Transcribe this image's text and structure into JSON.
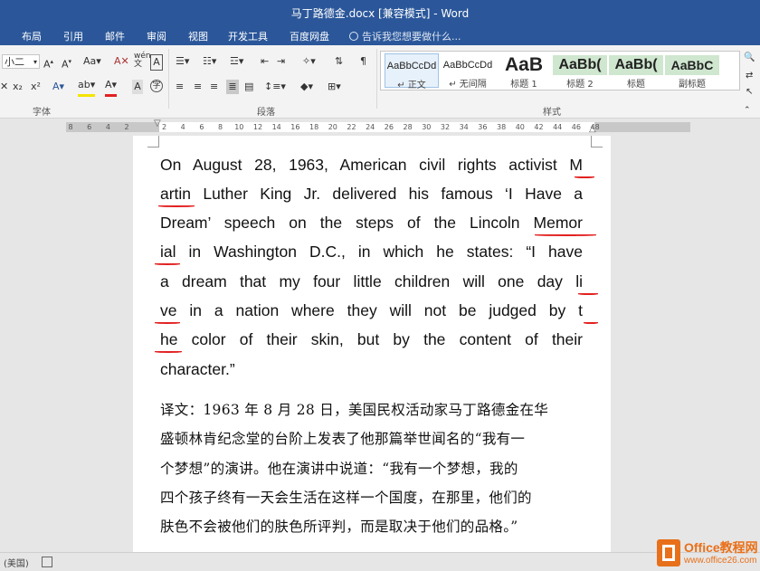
{
  "window": {
    "title": "马丁路德金.docx [兼容模式] - Word"
  },
  "tabs": [
    "布局",
    "引用",
    "邮件",
    "审阅",
    "视图",
    "开发工具",
    "百度网盘"
  ],
  "tell_me": "告诉我您想要做什么...",
  "ribbon": {
    "font_size": "小二",
    "font_group_label": "字体",
    "paragraph_group_label": "段落",
    "styles_group_label": "样式",
    "styles": [
      {
        "preview": "AaBbCcDd",
        "name": "↵ 正文"
      },
      {
        "preview": "AaBbCcDd",
        "name": "↵ 无间隔"
      },
      {
        "preview": "AaB",
        "name": "标题 1"
      },
      {
        "preview": "AaBb(",
        "name": "标题 2"
      },
      {
        "preview": "AaBb(",
        "name": "标题"
      },
      {
        "preview": "AaBbC",
        "name": "副标题"
      }
    ]
  },
  "ruler": {
    "ticks": [
      "8",
      "6",
      "4",
      "2",
      "",
      "2",
      "4",
      "6",
      "8",
      "10",
      "12",
      "14",
      "16",
      "18",
      "20",
      "22",
      "24",
      "26",
      "28",
      "30",
      "32",
      "34",
      "36",
      "38",
      "40",
      "42",
      "44",
      "46",
      "48"
    ]
  },
  "document": {
    "english_lines": [
      "On August 28, 1963, American civil rights activist M",
      "artin Luther King Jr. delivered his famous ‘I Have a",
      " Dream’ speech on the steps of the Lincoln Memor",
      "ial in Washington D.C., in which he states: “I have",
      "a dream that my four little children will one day li",
      "ve in a nation where they will not be judged by t",
      "he color of their skin, but by the content of their",
      "character.”"
    ],
    "chinese_lines": [
      "译文：1963 年 8 月 28 日，美国民权活动家马丁路德金在华",
      "盛顿林肯纪念堂的台阶上发表了他那篇举世闻名的“我有一",
      "个梦想”的演讲。他在演讲中说道：“我有一个梦想，我的",
      "四个孩子终有一天会生活在这样一个国度，在那里，他们的",
      "肤色不会被他们的肤色所评判，而是取决于他们的品格。”"
    ]
  },
  "status": {
    "language": "(美国)"
  },
  "watermark": {
    "brand": "Office教程网",
    "url": "www.office26.com"
  },
  "colors": {
    "accent": "#2b579a",
    "underline": "#e22020",
    "watermark": "#e8701a"
  }
}
